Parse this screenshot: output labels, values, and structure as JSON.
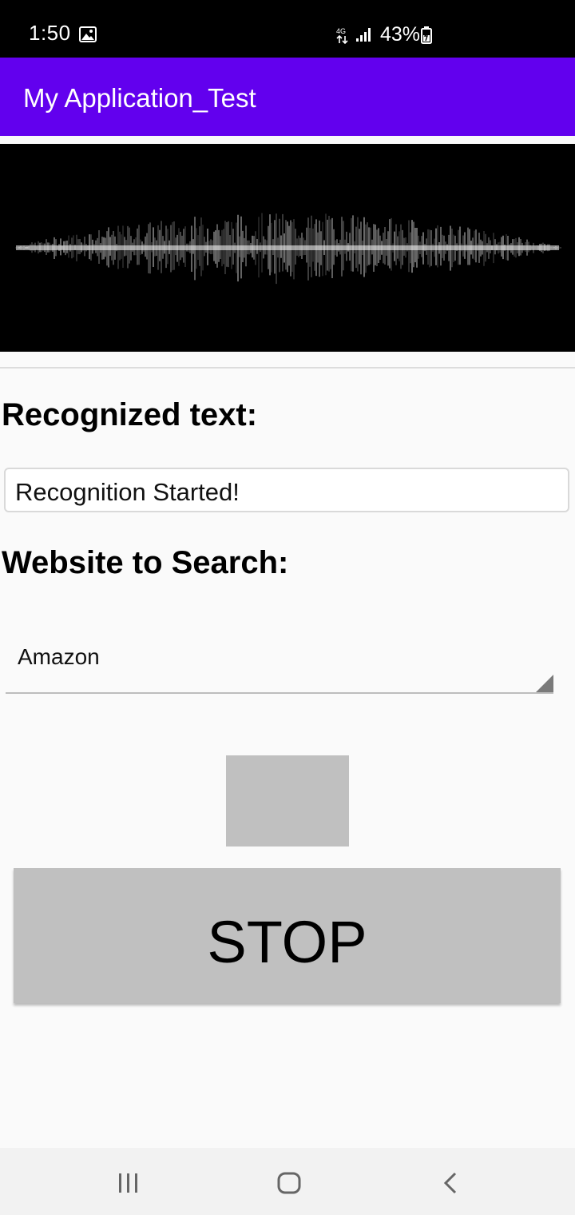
{
  "status_bar": {
    "time": "1:50",
    "battery": "43%",
    "icons": [
      "gallery-icon",
      "network-4g-icon",
      "signal-icon",
      "battery-icon"
    ]
  },
  "app_bar": {
    "title": "My Application_Test",
    "color": "#6200ee"
  },
  "recognized": {
    "heading": "Recognized text:",
    "value": "Recognition Started!"
  },
  "website": {
    "heading": "Website to Search:",
    "selected": "Amazon"
  },
  "stop_button": {
    "label": "STOP"
  },
  "nav_bar": {
    "icons": [
      "recents-icon",
      "home-icon",
      "back-icon"
    ]
  }
}
